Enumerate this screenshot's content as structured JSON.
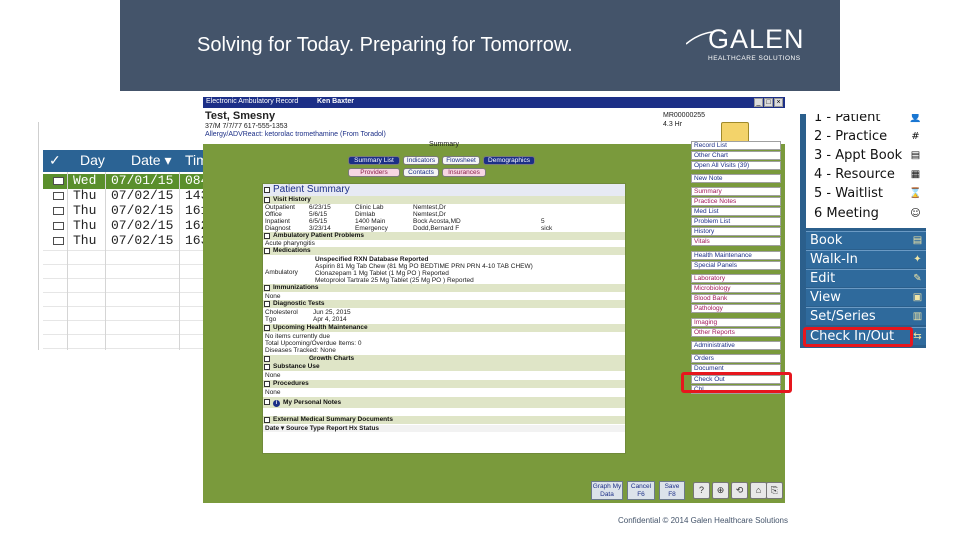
{
  "slide": {
    "tagline": "Solving for Today. Preparing for Tomorrow.",
    "logo_word": "GALEN",
    "logo_sub": "HEALTHCARE SOLUTIONS",
    "footer": "Confidential © 2014 Galen Healthcare Solutions"
  },
  "schedule": {
    "columns": [
      "✓",
      "Day",
      "Date ▾",
      "Tim"
    ],
    "rows": [
      {
        "day": "Wed",
        "date": "07/01/15",
        "time": "084"
      },
      {
        "day": "Thu",
        "date": "07/02/15",
        "time": "143"
      },
      {
        "day": "Thu",
        "date": "07/02/15",
        "time": "161"
      },
      {
        "day": "Thu",
        "date": "07/02/15",
        "time": "162"
      },
      {
        "day": "Thu",
        "date": "07/02/15",
        "time": "163"
      }
    ]
  },
  "right_menu": {
    "top_items": [
      {
        "label": "1 - Patient",
        "icon": "patient-icon"
      },
      {
        "label": "2 - Practice",
        "icon": "practice-icon"
      },
      {
        "label": "3 - Appt Book",
        "icon": "book-icon"
      },
      {
        "label": "4 - Resource",
        "icon": "resource-icon"
      },
      {
        "label": "5 - Waitlist",
        "icon": "waitlist-icon"
      },
      {
        "label": "6 Meeting",
        "icon": "meeting-icon"
      }
    ],
    "actions": [
      {
        "label": "Book",
        "icon": "book-icon"
      },
      {
        "label": "Walk-In",
        "icon": "walk-in-icon"
      },
      {
        "label": "Edit",
        "icon": "edit-icon"
      },
      {
        "label": "View",
        "icon": "view-icon"
      },
      {
        "label": "Set/Series",
        "icon": "series-icon"
      },
      {
        "label": "Check In/Out",
        "icon": "check-in-icon"
      }
    ],
    "accent": "#2b5f8c",
    "highlight": "#e6161d"
  },
  "emr": {
    "title": "Electronic Ambulatory Record",
    "user": "Ken Baxter",
    "patient_name": "Test, Smesny",
    "patient_line": "37/M 7/7/77 617-555-1353",
    "allergy_line": "Allergy/ADVReact: ketorolac tromethamine (From Toradol)",
    "summary_label": "Summary",
    "mrn": "MR00000255",
    "page": "4.3 Hr",
    "tabs": [
      {
        "label": "Summary List",
        "state": "active"
      },
      {
        "label": "Indicators",
        "state": "normal"
      },
      {
        "label": "Flowsheet",
        "state": "normal"
      },
      {
        "label": "Demographics",
        "state": "active"
      },
      {
        "label": "Providers",
        "state": "pink"
      },
      {
        "label": "Contacts",
        "state": "normal"
      },
      {
        "label": "Insurances",
        "state": "pink"
      }
    ],
    "summary": {
      "title": "Patient Summary",
      "sections": {
        "visit_history": "Visit History",
        "problems": "Ambulatory Patient Problems",
        "medications": "Medications",
        "immunizations": "Immunizations",
        "diagnostic": "Diagnostic Tests",
        "health_maint": "Upcoming Health Maintenance",
        "growth": "Growth Charts",
        "substance": "Substance Use",
        "procedures": "Procedures",
        "personal_notes": "My Personal Notes",
        "external": "External Medical Summary Documents"
      },
      "visits": [
        {
          "type": "Outpatient",
          "date": "6/23/15",
          "loc": "Clinic Lab",
          "prov": "Nemtest,Dr",
          "flag": ""
        },
        {
          "type": "Office",
          "date": "5/6/15",
          "loc": "Dimlab",
          "prov": "Nemtest,Dr",
          "flag": ""
        },
        {
          "type": "Inpatient",
          "date": "6/5/15",
          "loc": "1400 Main",
          "prov": "Bock Acosta,MD",
          "flag": "5"
        },
        {
          "type": "Diagnost",
          "date": "3/23/14",
          "loc": "Emergency",
          "prov": "Dodd,Bernard F",
          "flag": "sick"
        }
      ],
      "problem": "Acute pharyngitis",
      "med_header": "Unspecified RXN Database Reported",
      "med_type": "Ambulatory",
      "meds": [
        "Aspirin 81 Mg Tab Chew (81 Mg PO BEDTIME PRN PRN 4-10 TAB CHEW)",
        "Clonazepam 1 Mg Tablet (1 Mg PO ) Reported",
        "Metoprolol Tartrate 25 Mg Tablet (25 Mg PO ) Reported"
      ],
      "immun": "None",
      "tests": [
        {
          "name": "Cholesterol",
          "date": "Jun 25, 2015"
        },
        {
          "name": "Tgo",
          "date": "Apr 4, 2014"
        }
      ],
      "hm_lines": [
        "No items currently due",
        "Total Upcoming/Overdue Items: 0",
        "Diseases Tracked: None"
      ],
      "substance": "None",
      "procedures": "None",
      "ext_cols": "Date ▾ Source Type Report Hx Status"
    },
    "side_buttons": [
      {
        "label": "Record List",
        "style": "normal"
      },
      {
        "label": "Other Chart",
        "style": "normal"
      },
      {
        "label": "Open All Visits (39)",
        "style": "normal"
      },
      {
        "label": "New Note",
        "style": "normal"
      },
      {
        "label": "Summary",
        "style": "pink"
      },
      {
        "label": "Practice Notes",
        "style": "pink"
      },
      {
        "label": "Med List",
        "style": "normal"
      },
      {
        "label": "Problem List",
        "style": "normal"
      },
      {
        "label": "History",
        "style": "normal"
      },
      {
        "label": "Vitals",
        "style": "pink"
      },
      {
        "label": "Health Maintenance",
        "style": "normal"
      },
      {
        "label": "Special Panels",
        "style": "normal"
      },
      {
        "label": "Laboratory",
        "style": "pink"
      },
      {
        "label": "Microbiology",
        "style": "pink"
      },
      {
        "label": "Blood Bank",
        "style": "pink"
      },
      {
        "label": "Pathology",
        "style": "pink"
      },
      {
        "label": "Imaging",
        "style": "pink"
      },
      {
        "label": "Other Reports",
        "style": "pink"
      },
      {
        "label": "Administrative",
        "style": "normal"
      },
      {
        "label": "Orders",
        "style": "normal"
      },
      {
        "label": "Document",
        "style": "normal"
      },
      {
        "label": "Check Out",
        "style": "normal"
      },
      {
        "label": "Chl",
        "style": "normal"
      }
    ],
    "footer_buttons": [
      {
        "label": "Graph My Data",
        "icon": "graph-icon"
      },
      {
        "label": "Cancel F6",
        "icon": "cancel-icon"
      },
      {
        "label": "Save F8",
        "icon": "save-icon"
      }
    ],
    "footer_icons": [
      "?",
      "⊕",
      "⟲",
      "⌂",
      "⎘"
    ]
  }
}
